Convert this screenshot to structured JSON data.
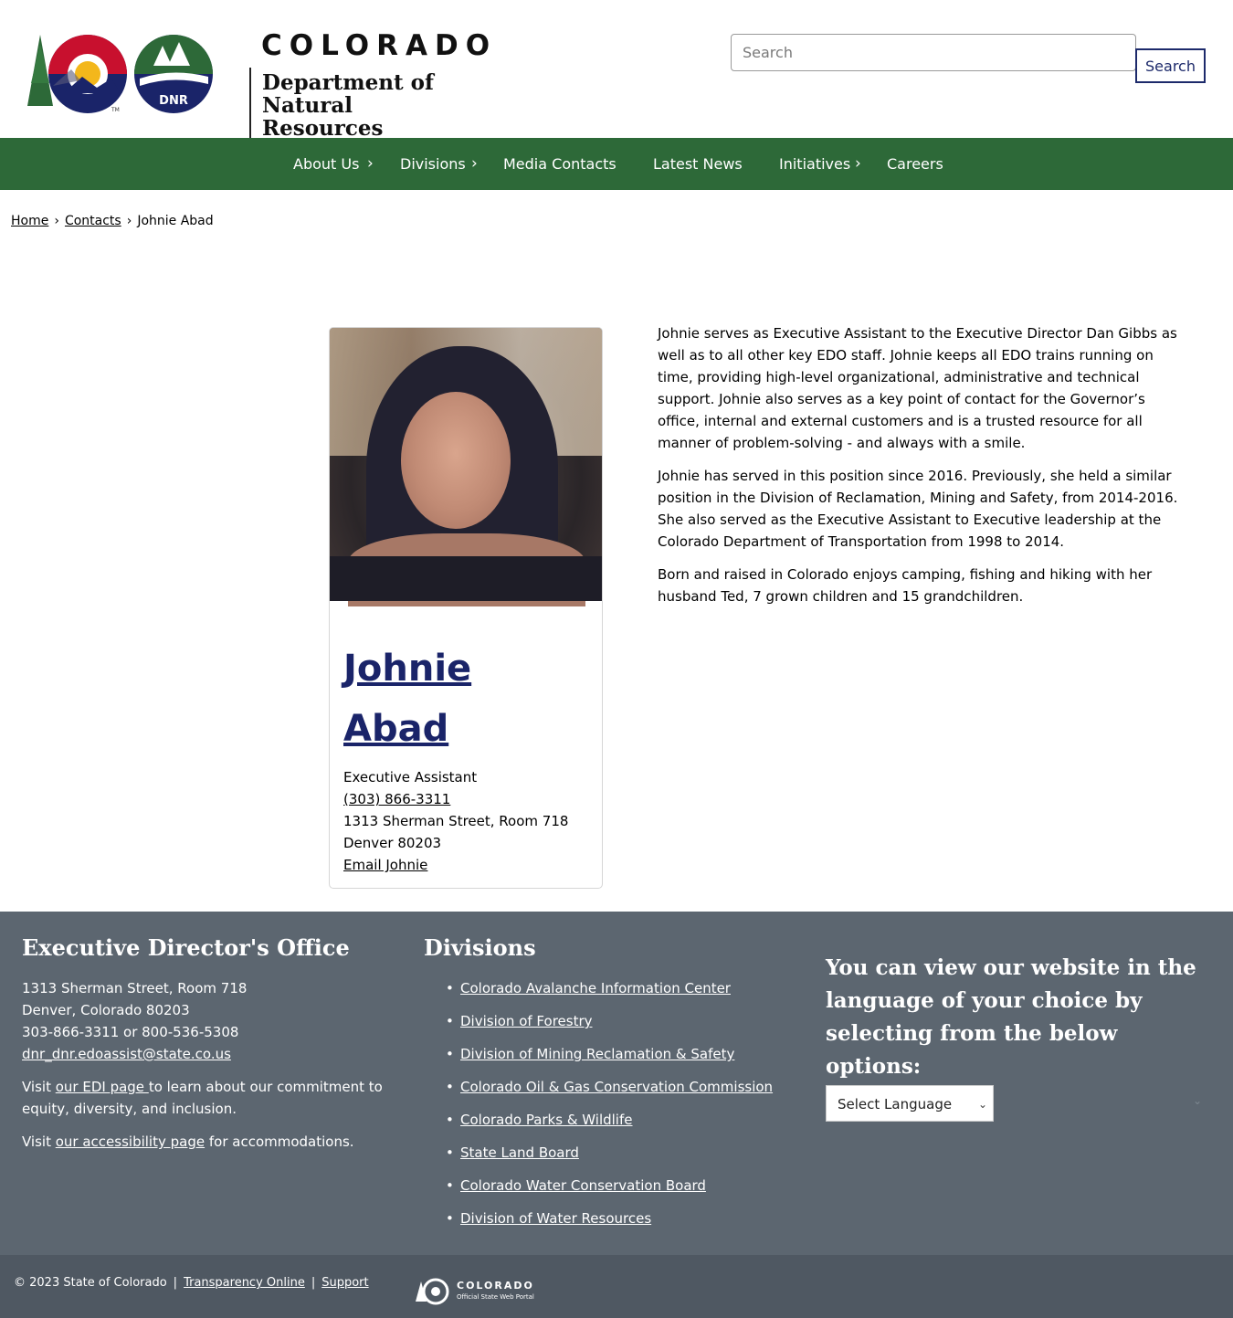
{
  "header": {
    "logo_co": "COLORADO",
    "logo_dept_line1": "Department of",
    "logo_dept_line2": "Natural Resources",
    "logo_dnr": "DNR",
    "logo_tm": "TM",
    "search_placeholder": "Search",
    "search_button": "Search"
  },
  "nav": {
    "items": [
      {
        "label": "About Us",
        "has_submenu": true
      },
      {
        "label": "Divisions",
        "has_submenu": true
      },
      {
        "label": "Media Contacts",
        "has_submenu": false
      },
      {
        "label": "Latest News",
        "has_submenu": false
      },
      {
        "label": "Initiatives",
        "has_submenu": true
      },
      {
        "label": "Careers",
        "has_submenu": false
      }
    ],
    "chevron": "›",
    "background": "#2d6938"
  },
  "breadcrumb": {
    "items": [
      "Home",
      "Contacts",
      "Johnie Abad"
    ],
    "separator": "›"
  },
  "profile": {
    "first_name": "Johnie",
    "last_name": "Abad",
    "title": "Executive Assistant",
    "phone": "(303) 866-3311",
    "address_line1": "1313 Sherman Street, Room 718",
    "address_line2": "Denver 80203",
    "email_link": "Email Johnie",
    "name_color": "#1a2469"
  },
  "bio": {
    "paragraphs": [
      "Johnie serves as Executive Assistant to the Executive Director Dan Gibbs as well as to all other key EDO staff. Johnie keeps all EDO trains running on time, providing high-level organizational, administrative and technical support. Johnie also serves as a key point of contact for the Governor’s office, internal and external customers and is a trusted resource for all manner of problem-solving - and always with a smile.",
      "Johnie has served in this position since 2016. Previously, she held a similar position in the Division of Reclamation, Mining and Safety, from 2014-2016. She also served as the Executive Assistant to Executive leadership at the Colorado Department of Transportation from 1998 to 2014.",
      "Born and raised in Colorado enjoys camping, fishing and hiking with her husband Ted, 7 grown children and 15 grandchildren."
    ]
  },
  "footer": {
    "col1": {
      "heading": "Executive Director's Office",
      "address_line1": "1313 Sherman Street, Room 718",
      "address_line2": "Denver, Colorado 80203",
      "phones": "303-866-3311 or 800-536-5308",
      "email": "dnr_dnr.edoassist@state.co.us",
      "edi_prefix": "Visit ",
      "edi_link": "our EDI page ",
      "edi_suffix": "to learn about our commitment to equity, diversity, and inclusion.",
      "access_prefix": "Visit ",
      "access_link": "our accessibility page",
      "access_suffix": " for accommodations."
    },
    "col2": {
      "heading": "Divisions",
      "links": [
        "Colorado Avalanche Information Center",
        "Division of Forestry",
        "Division of Mining Reclamation & Safety",
        "Colorado Oil & Gas Conservation Commission",
        "Colorado Parks & Wildlife",
        "State Land Board",
        "Colorado Water Conservation Board",
        "Division of Water Resources"
      ]
    },
    "col3": {
      "heading": "You can view our website in the language of your choice by selecting from the below options:",
      "select_value": "Select Language"
    },
    "background": "#5c6670"
  },
  "bottom_bar": {
    "copyright": "© 2023 State of Colorado",
    "transparency": "Transparency Online",
    "support": "Support",
    "pipe": "|",
    "portal_name": "COLORADO",
    "portal_sub": "Official State Web Portal"
  }
}
